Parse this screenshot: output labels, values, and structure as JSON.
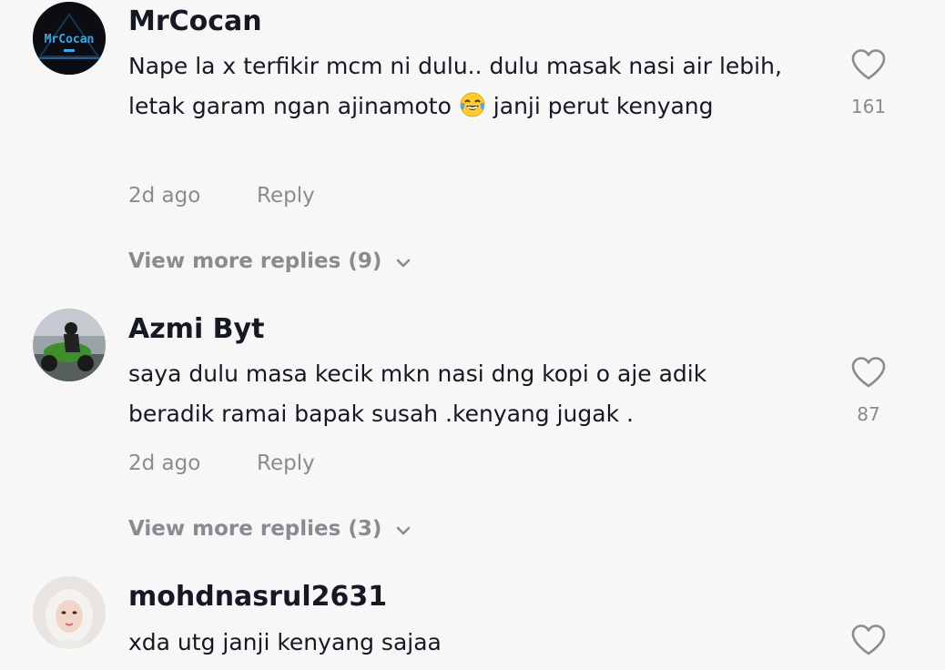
{
  "comments": [
    {
      "username": "MrCocan",
      "avatar_text": "MrCocan",
      "text_before_emoji": "Nape la x terfikir mcm ni dulu.. dulu masak nasi air lebih, letak garam ngan ajinamoto ",
      "emoji": "face-with-tears-of-joy",
      "text_after_emoji": " janji perut kenyang",
      "time": "2d ago",
      "reply_label": "Reply",
      "likes": "161",
      "view_more": "View more replies (9)"
    },
    {
      "username": "Azmi Byt",
      "avatar": "person-on-green-motorcycle",
      "text": "saya dulu masa kecik mkn nasi dng kopi o aje adik beradik ramai bapak susah .kenyang jugak .",
      "time": "2d ago",
      "reply_label": "Reply",
      "likes": "87",
      "view_more": "View more replies (3)"
    },
    {
      "username": "mohdnasrul2631",
      "avatar": "woman-in-hijab",
      "text": "xda utg janji kenyang sajaa"
    }
  ],
  "colors": {
    "background": "#f7f7f7",
    "primary_text": "#161823",
    "secondary_text": "#8a8b91"
  },
  "icons": {
    "like": "heart-outline-icon",
    "expand": "chevron-down-icon"
  }
}
